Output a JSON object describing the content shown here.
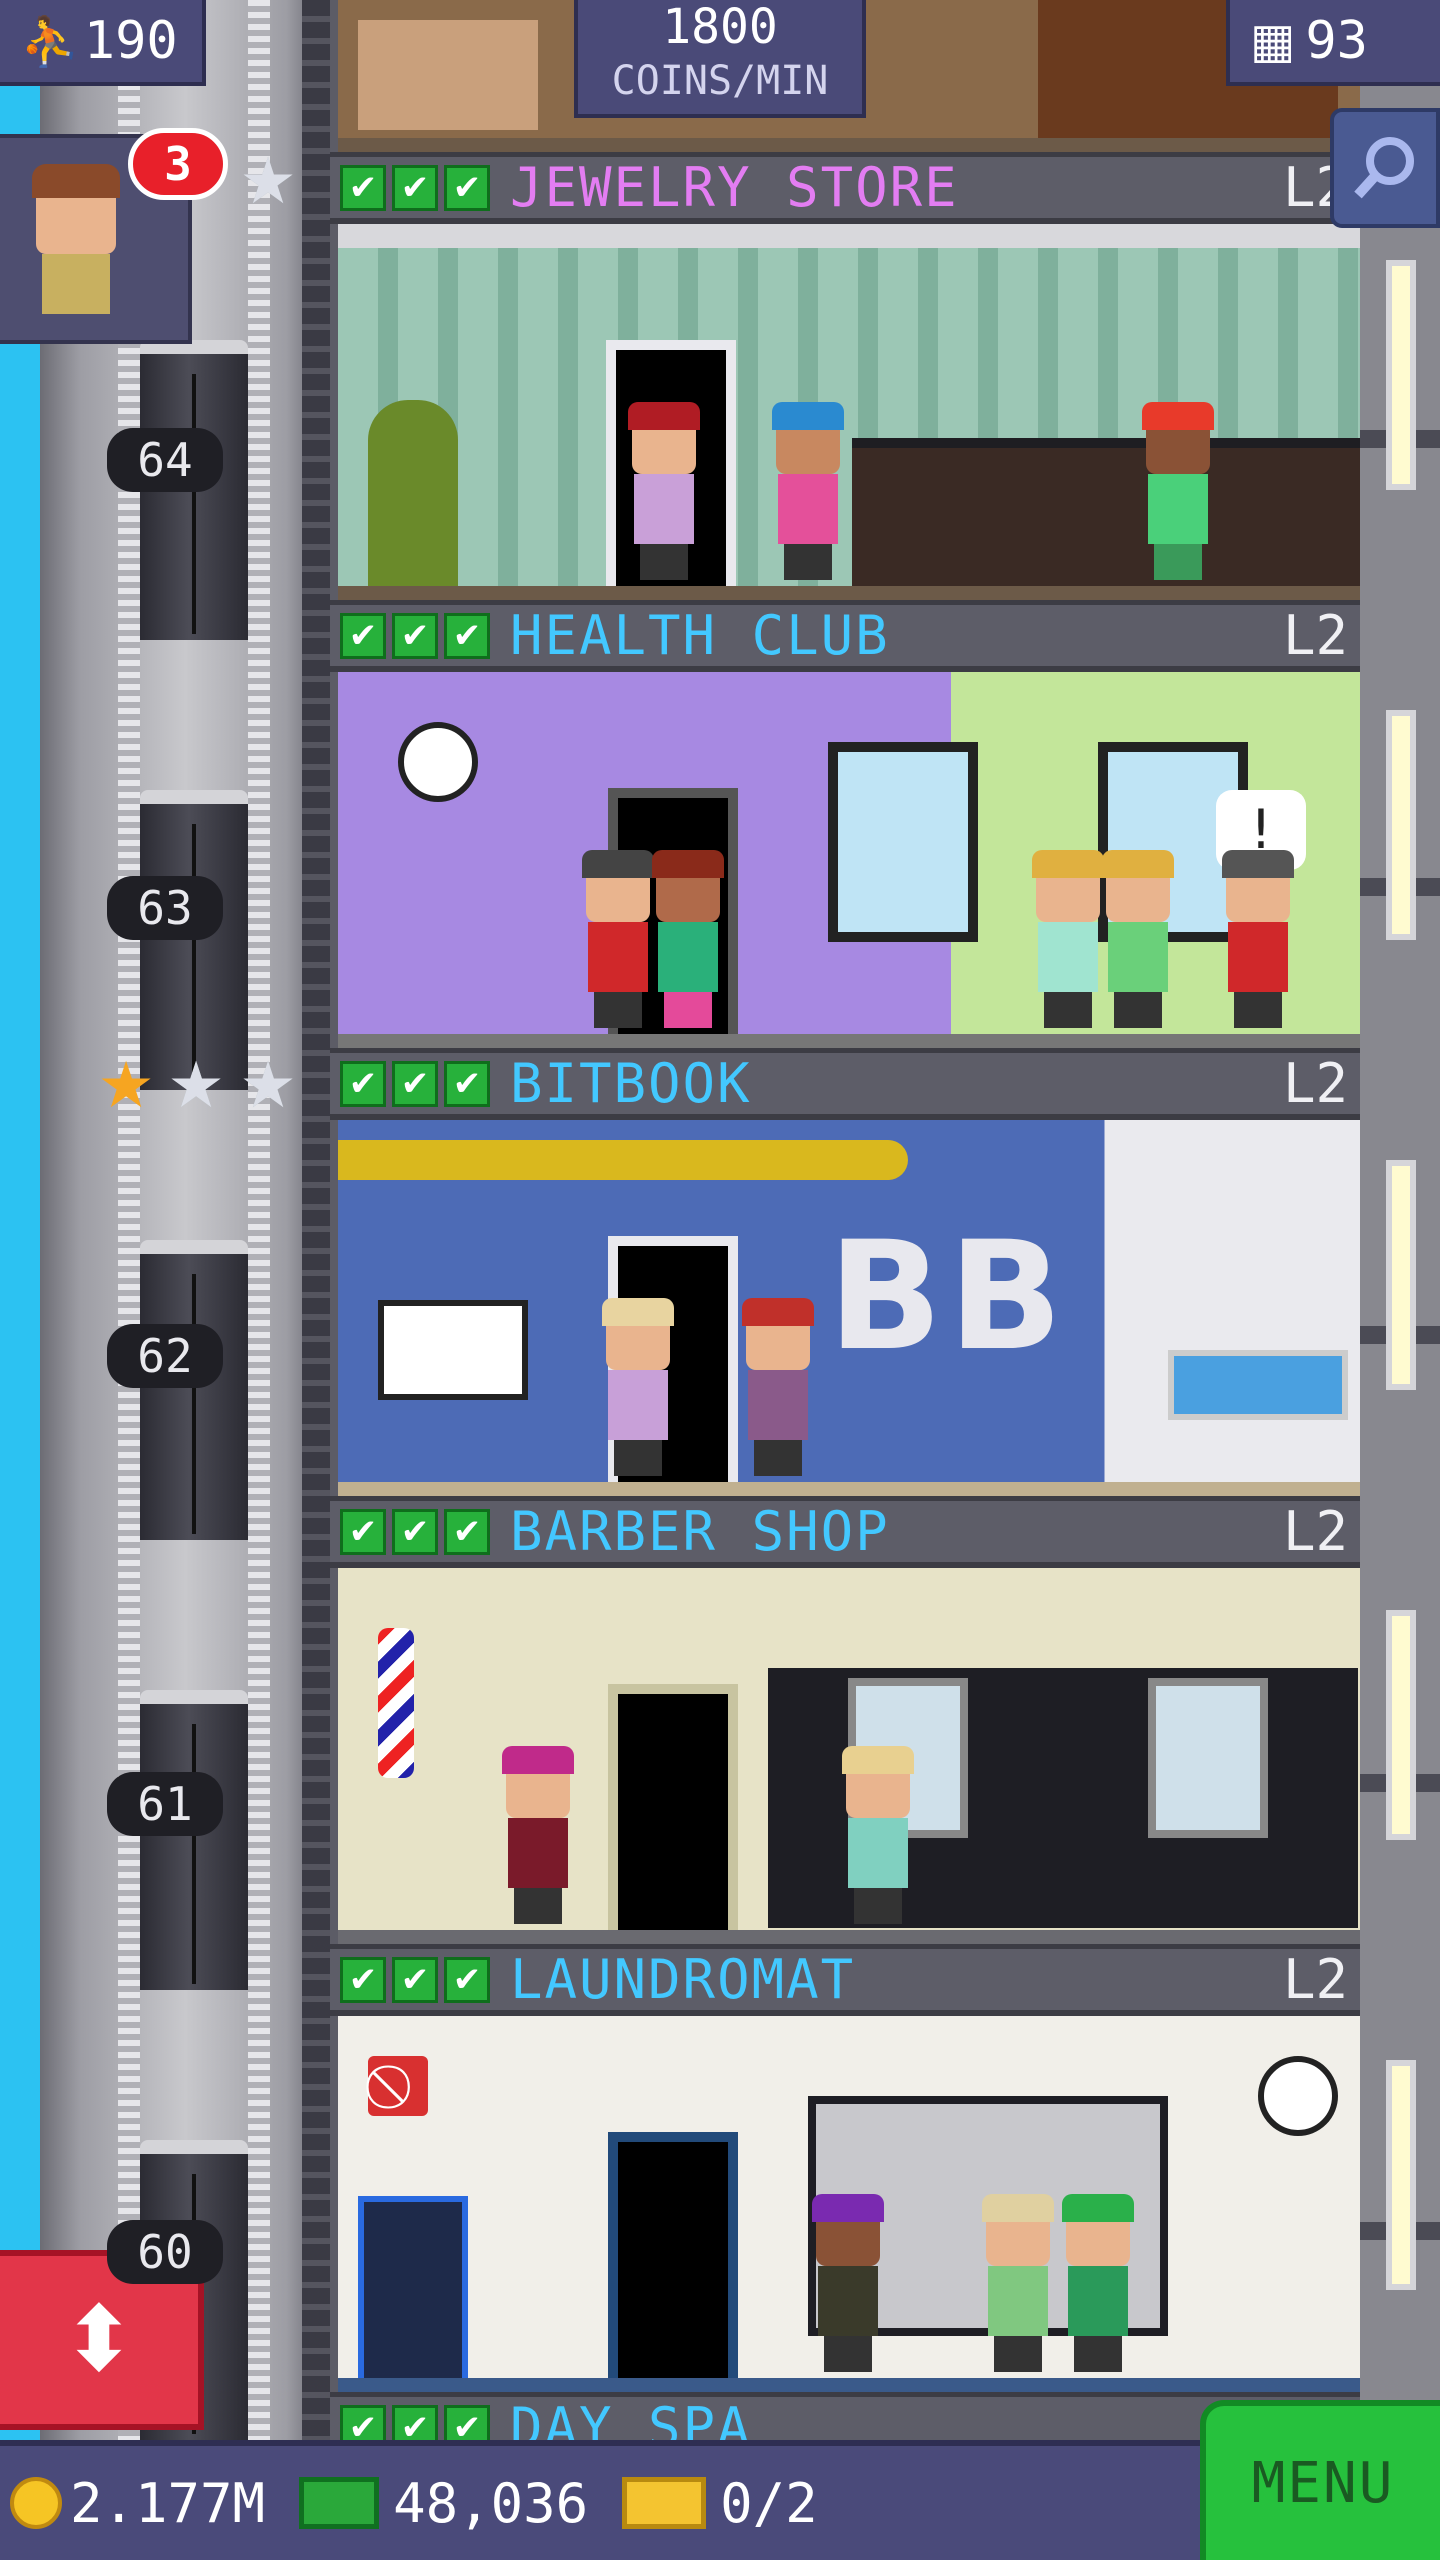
{
  "hud": {
    "population": "190",
    "coins_per_min_value": "1800",
    "coins_per_min_label": "COINS/MIN",
    "floors": "93",
    "visitor_badge": "3"
  },
  "elevator": {
    "floor_numbers": [
      "64",
      "63",
      "62",
      "61",
      "60"
    ]
  },
  "floors": [
    {
      "name": "JEWELRY STORE",
      "level": "L2",
      "name_color": "#e37df2"
    },
    {
      "name": "HEALTH CLUB",
      "level": "L2",
      "name_color": "#43c8ff"
    },
    {
      "name": "BITBOOK",
      "level": "L2",
      "name_color": "#43c8ff"
    },
    {
      "name": "BARBER SHOP",
      "level": "L2",
      "name_color": "#43c8ff"
    },
    {
      "name": "LAUNDROMAT",
      "level": "L2",
      "name_color": "#43c8ff"
    },
    {
      "name": "DAY SPA",
      "level": "",
      "name_color": "#43c8ff"
    }
  ],
  "room_text": {
    "bitbook_sign": "BB",
    "speech_bubble": "!"
  },
  "bottom_bar": {
    "coins": "2.177M",
    "bux": "48,036",
    "tickets": "0/2",
    "menu_label": "MENU"
  },
  "colors": {
    "check_green": "#27b13b",
    "menu_green": "#26c13d",
    "lift_red": "#e23649",
    "sky": "#2cc2f2"
  },
  "icons": [
    "person-icon",
    "building-icon",
    "search-icon",
    "check-icon",
    "star-icon",
    "coin-icon",
    "bux-icon",
    "ticket-icon",
    "elevator-arrows-icon"
  ]
}
